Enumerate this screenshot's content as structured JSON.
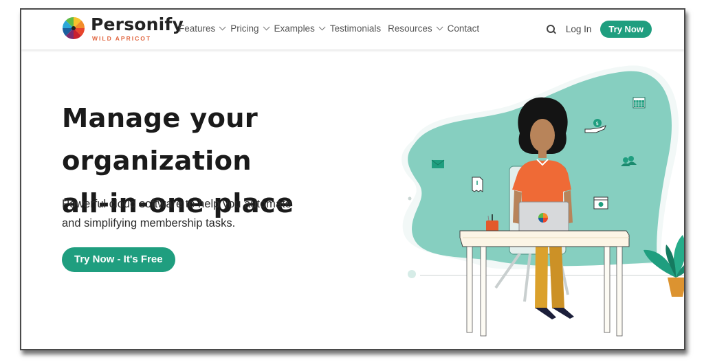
{
  "brand": {
    "name": "Personify",
    "subtitle": "WILD APRICOT",
    "accent_color": "#1f9e7f",
    "subtitle_color": "#e0643e"
  },
  "nav": {
    "items": [
      {
        "label": "Features",
        "has_dropdown": true
      },
      {
        "label": "Pricing",
        "has_dropdown": true
      },
      {
        "label": "Examples",
        "has_dropdown": true
      },
      {
        "label": "Testimonials",
        "has_dropdown": false
      },
      {
        "label": "Resources",
        "has_dropdown": true
      },
      {
        "label": "Contact",
        "has_dropdown": false
      }
    ],
    "search_icon": "search-icon",
    "login_label": "Log In",
    "cta_label": "Try Now"
  },
  "hero": {
    "title_line1": "Manage your organization",
    "title_line2": "all-in-one place",
    "subtitle_line1": "Powerful cloud software to help you automate",
    "subtitle_line2": "and simplifying membership tasks.",
    "cta_label": "Try Now - It's Free"
  },
  "illustration": {
    "description": "Woman working at desk with laptop, surrounded by feature icons",
    "icons": [
      "envelope-icon",
      "document-icon",
      "money-hand-icon",
      "calendar-icon",
      "people-icon",
      "settings-window-icon"
    ],
    "blob_color": "#86cfc0",
    "shirt_color": "#ef6a36",
    "pants_color": "#dba12c"
  }
}
